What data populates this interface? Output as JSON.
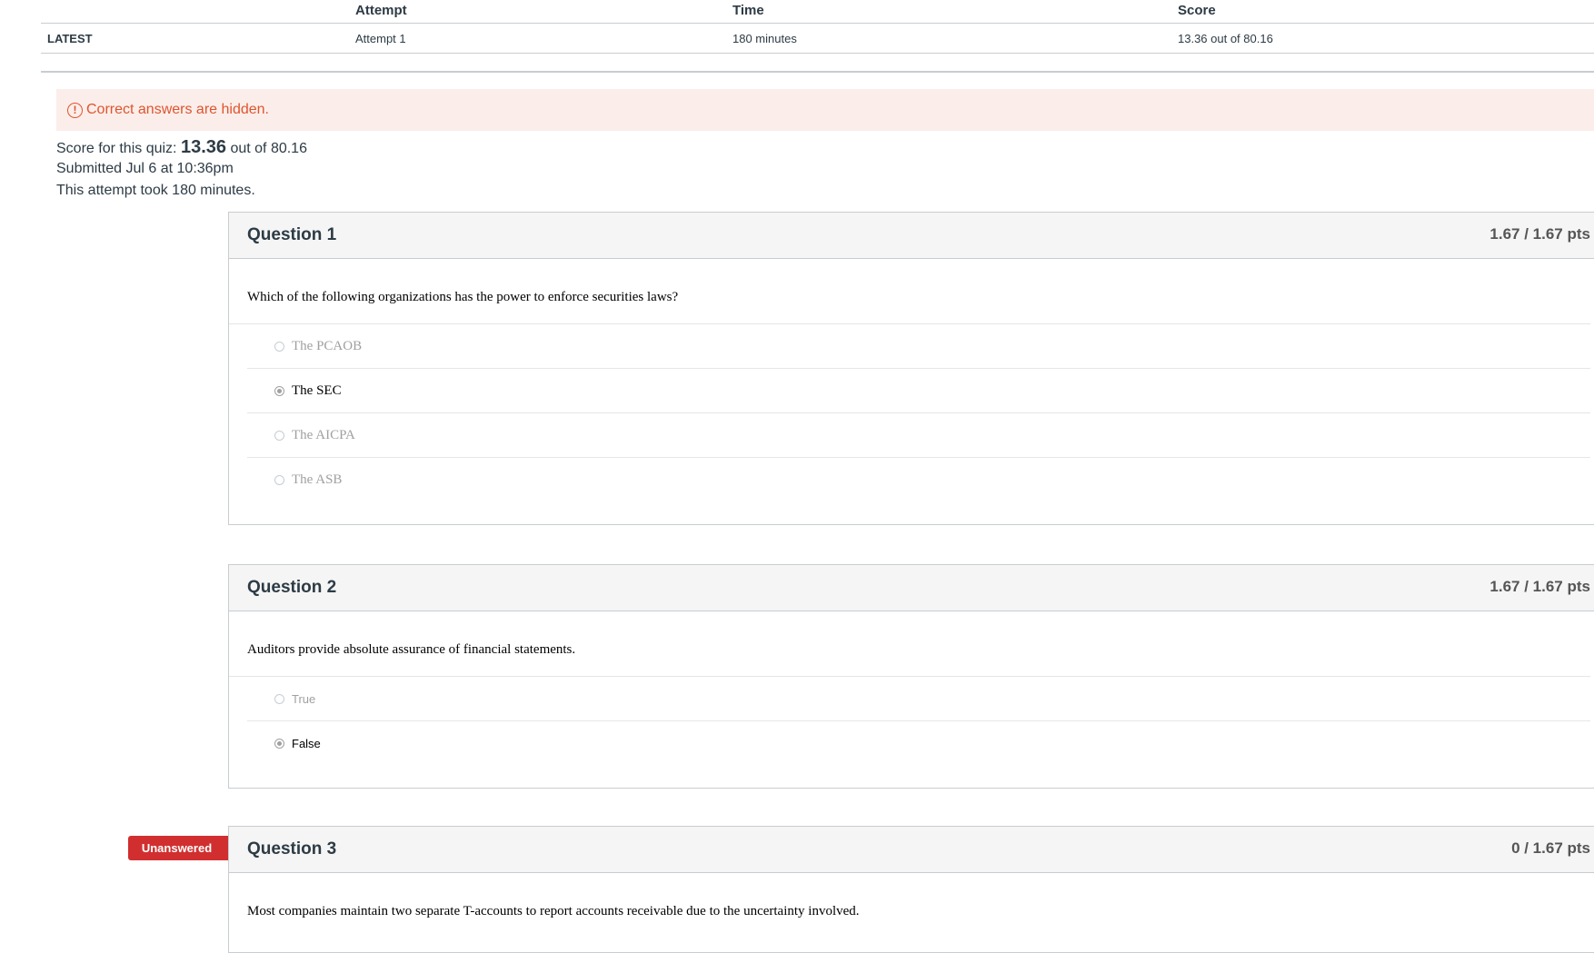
{
  "attempts_table": {
    "headers": {
      "attempt": "Attempt",
      "time": "Time",
      "score": "Score"
    },
    "row": {
      "label": "LATEST",
      "attempt": "Attempt 1",
      "time": "180 minutes",
      "score": "13.36 out of 80.16"
    }
  },
  "alert": {
    "icon": "exclamation-circle-icon",
    "text": "Correct answers are hidden."
  },
  "summary": {
    "score_prefix": "Score for this quiz: ",
    "score_value": "13.36",
    "score_suffix": " out of 80.16",
    "submitted": "Submitted Jul 6 at 10:36pm",
    "duration": "This attempt took 180 minutes."
  },
  "questions": [
    {
      "title": "Question 1",
      "points": "1.67 / 1.67 pts",
      "text": "Which of the following organizations has the power to enforce securities laws?",
      "answers": [
        {
          "label": "The PCAOB",
          "selected": false
        },
        {
          "label": "The SEC",
          "selected": true
        },
        {
          "label": "The AICPA",
          "selected": false
        },
        {
          "label": "The ASB",
          "selected": false
        }
      ]
    },
    {
      "title": "Question 2",
      "points": "1.67 / 1.67 pts",
      "text": "Auditors provide absolute assurance of financial statements.",
      "answers": [
        {
          "label": "True",
          "selected": false
        },
        {
          "label": "False",
          "selected": true
        }
      ]
    },
    {
      "title": "Question 3",
      "points": "0 / 1.67 pts",
      "tag": "Unanswered",
      "text": "Most companies maintain two separate T-accounts to report accounts receivable due to the uncertainty involved."
    }
  ],
  "colors": {
    "alert_bg": "#fbeeea",
    "alert_text": "#e0542f",
    "tag_bg": "#d12f2f",
    "header_bg": "#f5f5f5"
  }
}
